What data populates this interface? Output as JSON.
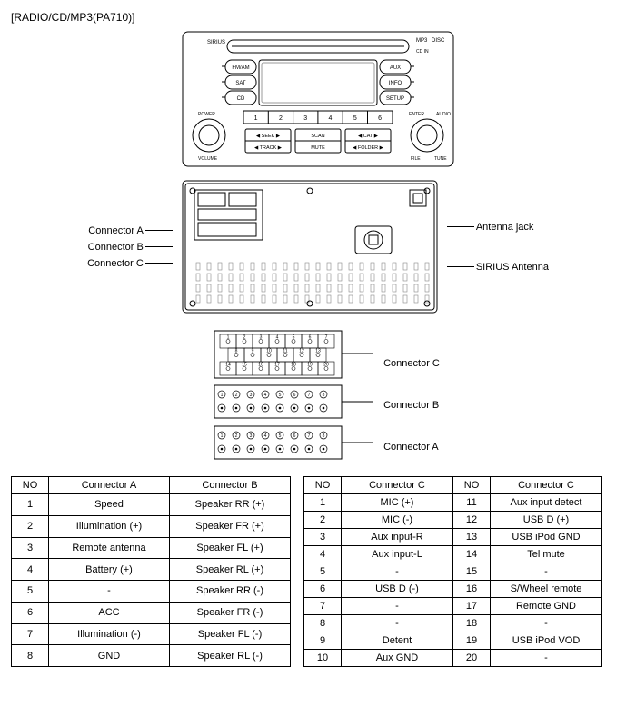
{
  "title": "[RADIO/CD/MP3(PA710)]",
  "faceplate": {
    "brand": "SIRIUS",
    "mp3_logo": "MP3",
    "disc_logo": "DISC",
    "cd_in": "CD IN",
    "left_buttons": [
      "FM/AM",
      "SAT",
      "CD"
    ],
    "right_buttons": [
      "AUX",
      "INFO",
      "SETUP"
    ],
    "left_knob_top": "POWER",
    "left_knob_label": "VOLUME",
    "right_knob_top_left": "ENTER",
    "right_knob_top_right": "AUDIO",
    "right_knob_label_left": "FILE",
    "right_knob_label_right": "TUNE",
    "presets": [
      "1",
      "2",
      "3",
      "4",
      "5",
      "6"
    ],
    "bottom_buttons": [
      {
        "top": "SEEK",
        "bottom": "TRACK",
        "arrows": true
      },
      {
        "top": "SCAN",
        "bottom": "MUTE",
        "arrows": false
      },
      {
        "top": "CAT",
        "bottom": "FOLDER",
        "arrows": true
      }
    ]
  },
  "rear_view": {
    "left_callouts": [
      "Connector A",
      "Connector B",
      "Connector C"
    ],
    "right_callouts": [
      "Antenna jack",
      "SIRIUS Antenna"
    ]
  },
  "pinout_block": {
    "connC_rows": [
      [
        "1",
        "2",
        "3",
        "4",
        "5",
        "6",
        "7"
      ],
      [
        "8",
        "9",
        "10",
        "11",
        "12",
        "13"
      ],
      [
        "14",
        "15",
        "16",
        "17",
        "18",
        "19",
        "20"
      ]
    ],
    "connB_rows": [
      [
        "1",
        "2",
        "3",
        "4",
        "5",
        "6",
        "7",
        "8"
      ]
    ],
    "connA_rows": [
      [
        "1",
        "2",
        "3",
        "4",
        "5",
        "6",
        "7",
        "8"
      ]
    ],
    "right_callouts": [
      "Connector C",
      "Connector B",
      "Connector A"
    ]
  },
  "table1": {
    "headers": [
      "NO",
      "Connector A",
      "Connector B"
    ],
    "rows": [
      [
        "1",
        "Speed",
        "Speaker RR (+)"
      ],
      [
        "2",
        "Illumination (+)",
        "Speaker FR (+)"
      ],
      [
        "3",
        "Remote antenna",
        "Speaker FL (+)"
      ],
      [
        "4",
        "Battery (+)",
        "Speaker RL (+)"
      ],
      [
        "5",
        "-",
        "Speaker RR (-)"
      ],
      [
        "6",
        "ACC",
        "Speaker FR (-)"
      ],
      [
        "7",
        "Illumination (-)",
        "Speaker FL (-)"
      ],
      [
        "8",
        "GND",
        "Speaker RL (-)"
      ]
    ]
  },
  "table2": {
    "headers": [
      "NO",
      "Connector C",
      "NO",
      "Connector C"
    ],
    "rows": [
      [
        "1",
        "MIC (+)",
        "11",
        "Aux input detect"
      ],
      [
        "2",
        "MIC (-)",
        "12",
        "USB D (+)"
      ],
      [
        "3",
        "Aux input-R",
        "13",
        "USB iPod GND"
      ],
      [
        "4",
        "Aux input-L",
        "14",
        "Tel mute"
      ],
      [
        "5",
        "-",
        "15",
        "-"
      ],
      [
        "6",
        "USB D (-)",
        "16",
        "S/Wheel remote"
      ],
      [
        "7",
        "-",
        "17",
        "Remote GND"
      ],
      [
        "8",
        "-",
        "18",
        "-"
      ],
      [
        "9",
        "Detent",
        "19",
        "USB iPod VOD"
      ],
      [
        "10",
        "Aux GND",
        "20",
        "-"
      ]
    ]
  }
}
